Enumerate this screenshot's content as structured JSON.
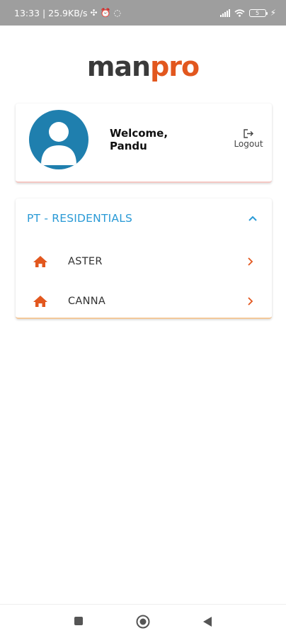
{
  "status_bar": {
    "time_speed": "13:33 | 25.9KB/s",
    "battery_level": "5",
    "icons": [
      "sync-icon",
      "alarm-icon",
      "whatsapp-icon",
      "signal-icon",
      "wifi-icon",
      "battery-icon",
      "charging-icon"
    ]
  },
  "logo": {
    "part1": "man",
    "part2": "pro",
    "brand_dark": "#3a3a3a",
    "brand_orange": "#e2571e"
  },
  "profile": {
    "welcome_line1": "Welcome,",
    "welcome_line2": "Pandu",
    "logout_label": "Logout",
    "avatar_color": "#1f7fae"
  },
  "project": {
    "title": "PT - RESIDENTIALS",
    "title_color": "#2a9ad6",
    "expanded": true,
    "sites": [
      {
        "label": "ASTER"
      },
      {
        "label": "CANNA"
      }
    ]
  },
  "nav": {
    "buttons": [
      "recents-button",
      "home-button",
      "back-button"
    ]
  }
}
